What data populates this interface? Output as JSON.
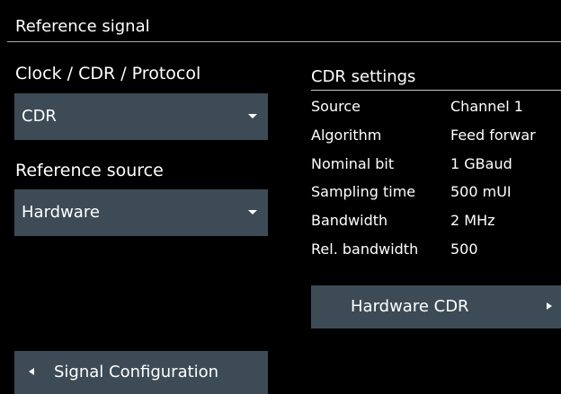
{
  "section": {
    "title": "Reference signal"
  },
  "left": {
    "clock_label": "Clock / CDR / Protocol",
    "clock_value": "CDR",
    "refsrc_label": "Reference source",
    "refsrc_value": "Hardware"
  },
  "cdr": {
    "title": "CDR settings",
    "rows": [
      {
        "key": "Source",
        "value": "Channel 1"
      },
      {
        "key": "Algorithm",
        "value": "Feed forwar"
      },
      {
        "key": "Nominal bit",
        "value": "1 GBaud"
      },
      {
        "key": "Sampling time",
        "value": "500 mUI"
      },
      {
        "key": "Bandwidth",
        "value": "2 MHz"
      },
      {
        "key": "Rel. bandwidth",
        "value": "500"
      }
    ],
    "hardware_button": "Hardware CDR"
  },
  "nav": {
    "signal_config_button": "Signal Configuration"
  },
  "icons": {
    "dropdown": "chevron-down-icon",
    "forward": "arrow-right-icon",
    "back": "arrow-left-icon"
  },
  "colors": {
    "background": "#000000",
    "control": "#3c4b55",
    "text": "#ffffff",
    "rule": "#a9a9a9"
  }
}
